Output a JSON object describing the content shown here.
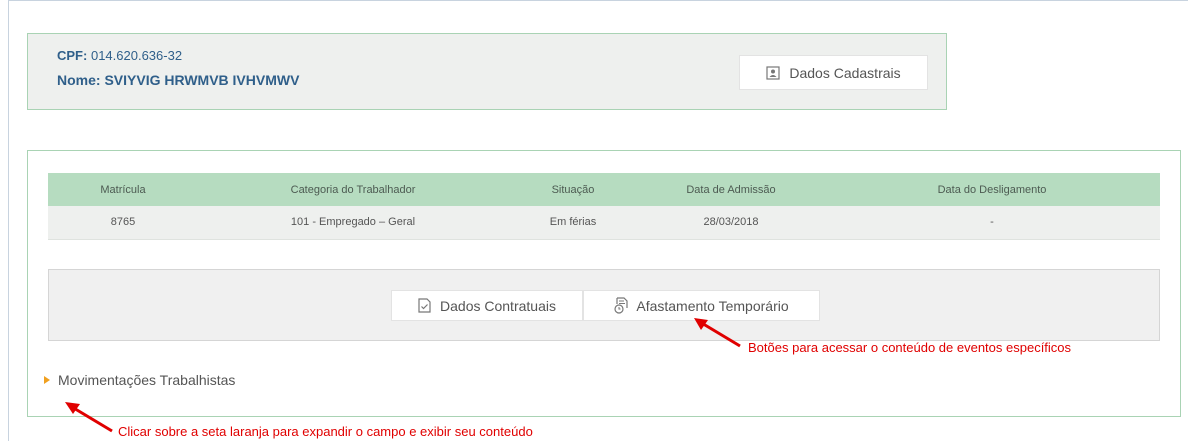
{
  "worker": {
    "cpf_label": "CPF:",
    "cpf_value": "014.620.636-32",
    "nome_label": "Nome:",
    "nome_value": "SVIYVIG HRWMVB IVHVMWV",
    "dados_cadastrais_button": "Dados Cadastrais",
    "dados_cadastrais_icon": "person-document-icon"
  },
  "table": {
    "headers": [
      "Matrícula",
      "Categoria do Trabalhador",
      "Situação",
      "Data de Admissão",
      "Data do Desligamento"
    ],
    "rows": [
      [
        "8765",
        "101 - Empregado – Geral",
        "Em férias",
        "28/03/2018",
        "-"
      ]
    ]
  },
  "buttons": {
    "dados_contratuais": "Dados Contratuais",
    "dados_contratuais_icon": "document-check-icon",
    "afastamento": "Afastamento Temporário",
    "afastamento_icon": "document-clock-icon"
  },
  "movimentacoes": {
    "label": "Movimentações Trabalhistas",
    "arrow_color": "#f0a020"
  },
  "annotations": {
    "buttons_note": "Botões para acessar o conteúdo de eventos específicos",
    "arrow_note": "Clicar sobre a seta laranja para expandir o campo e exibir seu conteúdo",
    "color": "#e00000"
  },
  "colors": {
    "header_green": "#b6dcc0",
    "panel_border": "#a9d3b4",
    "title_blue": "#2f5f8a"
  }
}
